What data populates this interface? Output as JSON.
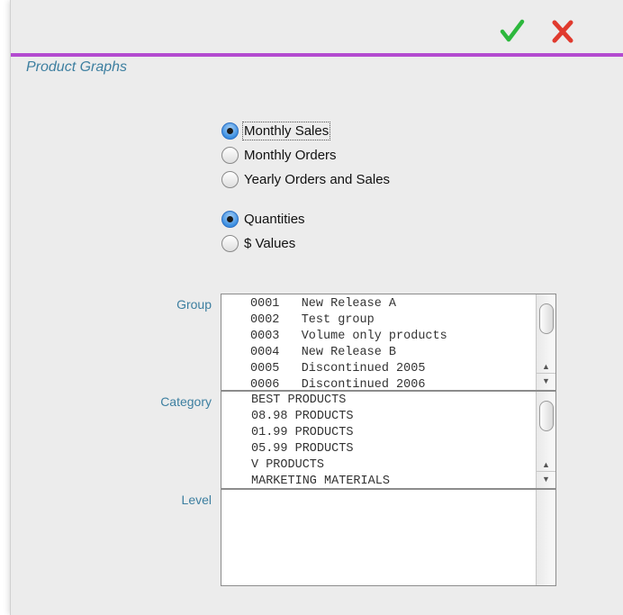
{
  "toolbar": {
    "ok_icon_color": "#2db83d",
    "cancel_icon_color": "#e03a2e"
  },
  "page": {
    "title": "Product Graphs"
  },
  "graph_type": {
    "options": [
      "Monthly Sales",
      "Monthly Orders",
      "Yearly Orders and Sales"
    ],
    "selected": "Monthly Sales"
  },
  "measure": {
    "options": [
      "Quantities",
      "$ Values"
    ],
    "selected": "Quantities"
  },
  "group": {
    "label": "Group",
    "items": [
      "0001   New Release A",
      "0002   Test group",
      "0003   Volume only products",
      "0004   New Release B",
      "0005   Discontinued 2005",
      "0006   Discontinued 2006"
    ]
  },
  "category": {
    "label": "Category",
    "items": [
      "BEST PRODUCTS",
      "08.98 PRODUCTS",
      "01.99 PRODUCTS",
      "05.99 PRODUCTS",
      "V PRODUCTS",
      "MARKETING MATERIALS"
    ]
  },
  "level": {
    "label": "Level",
    "items": []
  },
  "colors": {
    "accent_rule": "#b34bd0",
    "label_text": "#3d7fa0"
  }
}
